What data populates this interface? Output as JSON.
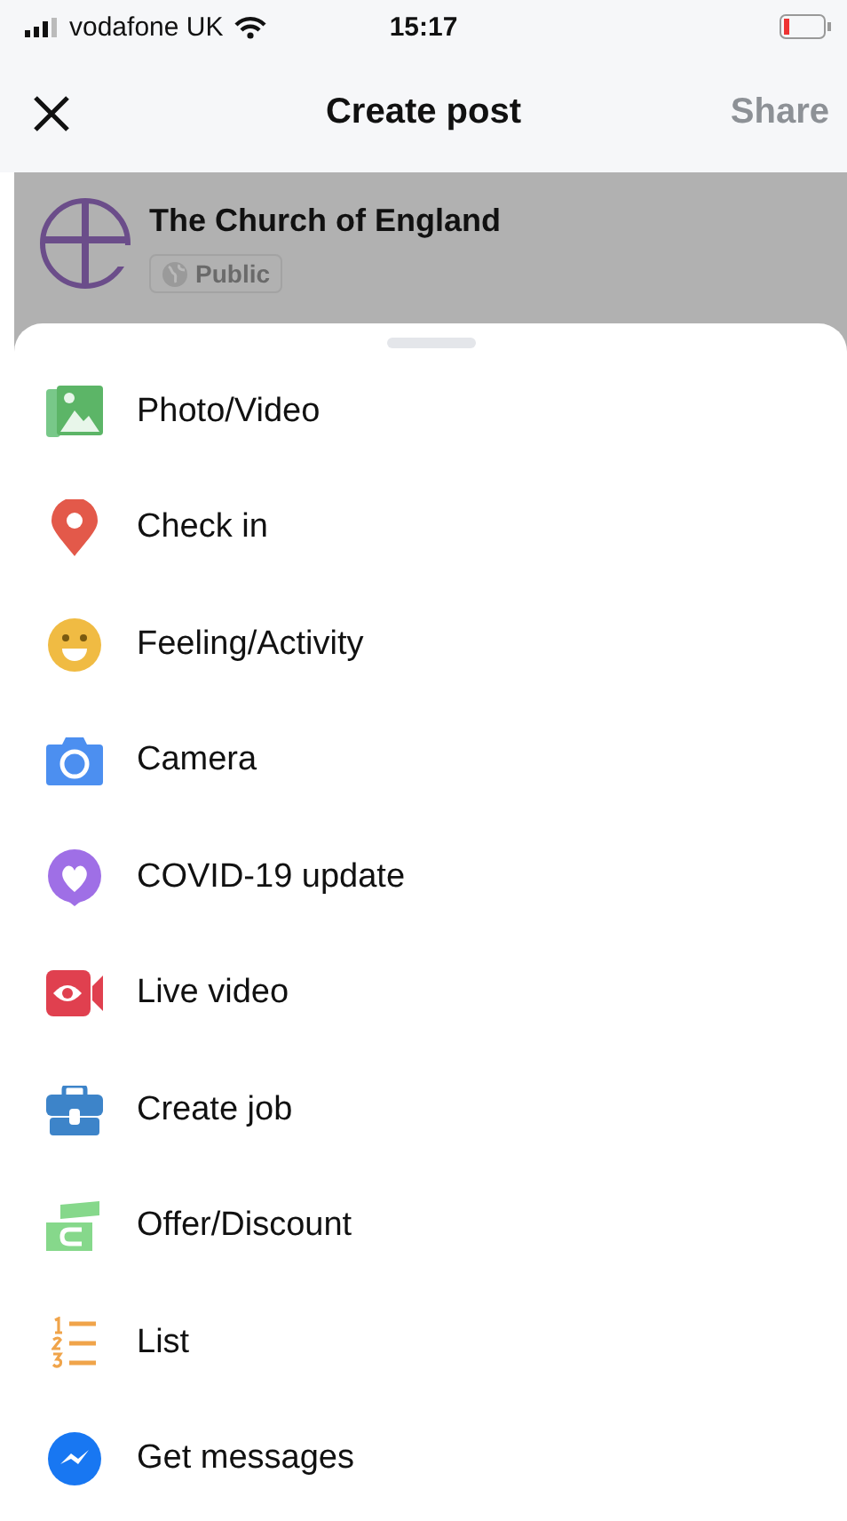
{
  "status_bar": {
    "carrier": "vodafone UK",
    "time": "15:17"
  },
  "header": {
    "title": "Create post",
    "action": "Share",
    "action_disabled": true
  },
  "page": {
    "name": "The Church of England",
    "audience": "Public"
  },
  "options": [
    {
      "kind": "photo",
      "label": "Photo/Video"
    },
    {
      "kind": "checkin",
      "label": "Check in"
    },
    {
      "kind": "feeling",
      "label": "Feeling/Activity"
    },
    {
      "kind": "camera",
      "label": "Camera"
    },
    {
      "kind": "covid",
      "label": "COVID-19 update"
    },
    {
      "kind": "live",
      "label": "Live video"
    },
    {
      "kind": "job",
      "label": "Create job"
    },
    {
      "kind": "offer",
      "label": "Offer/Discount"
    },
    {
      "kind": "list",
      "label": "List"
    },
    {
      "kind": "messages",
      "label": "Get messages"
    }
  ]
}
